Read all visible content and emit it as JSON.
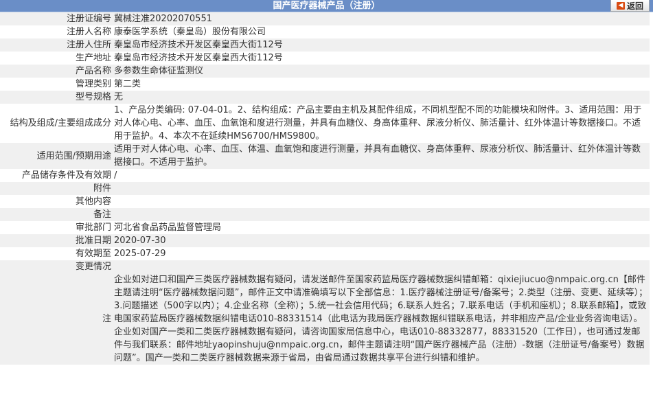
{
  "header": {
    "title": "国产医疗器械产品（注册）",
    "back_label": "返回"
  },
  "rows": [
    {
      "label": "注册证编号",
      "value": "冀械注准20202070551"
    },
    {
      "label": "注册人名称",
      "value": "康泰医学系统（秦皇岛）股份有限公司"
    },
    {
      "label": "注册人住所",
      "value": "秦皇岛市经济技术开发区秦皇西大街112号"
    },
    {
      "label": "生产地址",
      "value": "秦皇岛市经济技术开发区秦皇西大街112号"
    },
    {
      "label": "产品名称",
      "value": "多参数生命体征监测仪"
    },
    {
      "label": "管理类别",
      "value": "第二类"
    },
    {
      "label": "型号规格",
      "value": "无"
    },
    {
      "label": "结构及组成/主要组成成分",
      "value": "1、产品分类编码: 07-04-01。2、结构组成：产品主要由主机及其配件组成，不同机型配不同的功能模块和附件。3、适用范围：用于对人体心电、心率、血压、血氧饱和度进行测量，并具有血糖仪、身高体重秤、尿液分析仪、肺活量计、红外体温计等数据接口。不适用于监护。4、本次不在延续HMS6700/HMS9800。"
    },
    {
      "label": "适用范围/预期用途",
      "value": "适用于对人体心电、心率、血压、体温、血氧饱和度进行测量，并具有血糖仪、身高体重秤、尿液分析仪、肺活量计、红外体温计等数据接口。不适用于监护。"
    },
    {
      "label": "产品储存条件及有效期",
      "value": "/"
    },
    {
      "label": "附件",
      "value": ""
    },
    {
      "label": "其他内容",
      "value": ""
    },
    {
      "label": "备注",
      "value": ""
    },
    {
      "label": "审批部门",
      "value": "河北省食品药品监督管理局"
    },
    {
      "label": "批准日期",
      "value": "2020-07-30"
    },
    {
      "label": "有效期至",
      "value": "2025-07-29"
    },
    {
      "label": "变更情况",
      "value": ""
    }
  ],
  "note": {
    "label": "注",
    "text": "企业如对进口和国产三类医疗器械数据有疑问，请发送邮件至国家药监局医疗器械数据纠错邮箱：qixiejiucuo@nmpaic.org.cn【邮件主题请注明“医疗器械数据问题”，邮件正文中请准确填写以下全部信息：1.医疗器械注册证号/备案号；2.类型（注册、变更、延续等）；3.问题描述（500字以内）；4.企业名称（全称）；5.统一社会信用代码；6.联系人姓名；7.联系电话（手机和座机）；8.联系邮箱】，或致电国家药监局医疗器械数据纠错电话010-88331514（此电话为我局医疗器械数据纠错联系电话，并非相应产品/企业业务咨询电话）。企业如对国产一类和二类医疗器械数据有疑问，请咨询国家局信息中心，电话010-88332877，88331520（工作日），也可通过发邮件与我们联系：邮件地址yaopinshuju@nmpaic.org.cn，邮件主题请注明“国产医疗器械产品（注册）-数据（注册证号/备案号）数据问题”。国产一类和二类医疗器械数据来源于省局，由省局通过数据共享平台进行纠错和维护。"
  }
}
